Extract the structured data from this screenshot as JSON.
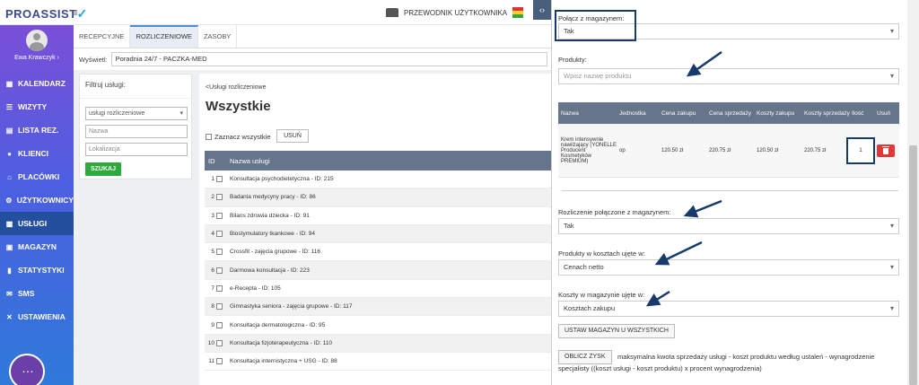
{
  "app": {
    "logo": "PROASSIST",
    "guide_label": "PRZEWODNIK UŻYTKOWNIKA",
    "toggle_label": "‹›"
  },
  "user": {
    "name": "Ewa Krawczyk ›"
  },
  "sidebar": {
    "items": [
      {
        "label": "KALENDARZ",
        "icon": "calendar-icon"
      },
      {
        "label": "WIZYTY",
        "icon": "list-icon"
      },
      {
        "label": "LISTA REZ.",
        "icon": "document-icon"
      },
      {
        "label": "KLIENCI",
        "icon": "users-icon"
      },
      {
        "label": "PLACÓWKI",
        "icon": "building-icon"
      },
      {
        "label": "UŻYTKOWNICY",
        "icon": "gear-icon"
      },
      {
        "label": "USŁUGI",
        "icon": "grid-icon"
      },
      {
        "label": "MAGAZYN",
        "icon": "box-icon"
      },
      {
        "label": "STATYSTYKI",
        "icon": "chart-icon"
      },
      {
        "label": "SMS",
        "icon": "sms-icon"
      },
      {
        "label": "USTAWIENIA",
        "icon": "wrench-icon"
      }
    ],
    "active_index": 6
  },
  "tabs": [
    "RECEPCYJNE",
    "ROZLICZENIOWE",
    "ZASOBY"
  ],
  "view": {
    "label": "Wyświetl:",
    "value": "Poradnia 24/7 - PACZKA-MED"
  },
  "filter": {
    "title": "Filtruj usługi:",
    "type_value": "usługi rozliczeniowe",
    "name_placeholder": "Nazwa",
    "location_placeholder": "Lokalizacja",
    "search_label": "SZUKAJ"
  },
  "content": {
    "breadcrumb": "<Usługi rozliczeniowe",
    "title": "Wszystkie",
    "select_all": "Zaznacz wszystkie",
    "delete_label": "USUŃ",
    "headers": [
      "ID",
      "Nazwa usługi"
    ],
    "rows": [
      {
        "id": "1",
        "name": "Konsultacja psychodietetyczna - ID: 215"
      },
      {
        "id": "2",
        "name": "Badania medycyny pracy - ID: 86"
      },
      {
        "id": "3",
        "name": "Bilans zdrowia dziecka - ID: 91"
      },
      {
        "id": "4",
        "name": "Biostymulatory tkankowe - ID: 94"
      },
      {
        "id": "5",
        "name": "Crossfit - zajęcia grupowe - ID: 116"
      },
      {
        "id": "6",
        "name": "Darmowa konsultacja - ID: 223"
      },
      {
        "id": "7",
        "name": "e-Recepta - ID: 105"
      },
      {
        "id": "8",
        "name": "Gimnastyka seniora - zajęcia grupowe - ID: 117"
      },
      {
        "id": "9",
        "name": "Konsultacja dermatologiczna - ID: 95"
      },
      {
        "id": "10",
        "name": "Konsultacja fizjoterapeutyczna - ID: 110"
      },
      {
        "id": "11",
        "name": "Konsultacja internistyczna + USG - ID: 88"
      }
    ]
  },
  "panel": {
    "link_label": "Połącz z magazynem:",
    "link_value": "Tak",
    "products_label": "Produkty:",
    "products_placeholder": "Wpisz nazwę produktu",
    "table_headers": [
      "Nazwa",
      "Jednostka",
      "Cena zakupu",
      "Cena sprzedaży",
      "Koszty zakupu",
      "Koszty sprzedaży",
      "Ilość",
      "Usuń"
    ],
    "product": {
      "name": "Krem intensywnie nawilżający (YONELLE Producent Kosmetyków PREMIUM)",
      "unit": "op",
      "buy_price": "120.50 zł",
      "sell_price": "220.75 zł",
      "buy_cost": "120.50 zł",
      "sell_cost": "220.75 zł",
      "qty": "1"
    },
    "settlement_label": "Rozliczenie połączone z magazynem:",
    "settlement_value": "Tak",
    "products_cost_label": "Produkty w kosztach ujęte w:",
    "products_cost_value": "Cenach netto",
    "warehouse_cost_label": "Koszty w magazynie ujęte w:",
    "warehouse_cost_value": "Kosztach zakupu",
    "set_all_label": "USTAW MAGAZYN U WSZYSTKICH",
    "calc_label": "OBLICZ ZYSK",
    "calc_text": "maksymalna kwota sprzedaży usługi - koszt produktu według ustaleń - wynagrodzenie specjalisty ((koszt usługi - koszt produktu) x procent wynagrodzenia)"
  },
  "colors": {
    "accent": "#173a6b",
    "sidebar_top": "#7b4fd8",
    "sidebar_bottom": "#2f79d9",
    "table_header": "#66758a",
    "success": "#2eaa3d",
    "danger": "#e0373a"
  }
}
